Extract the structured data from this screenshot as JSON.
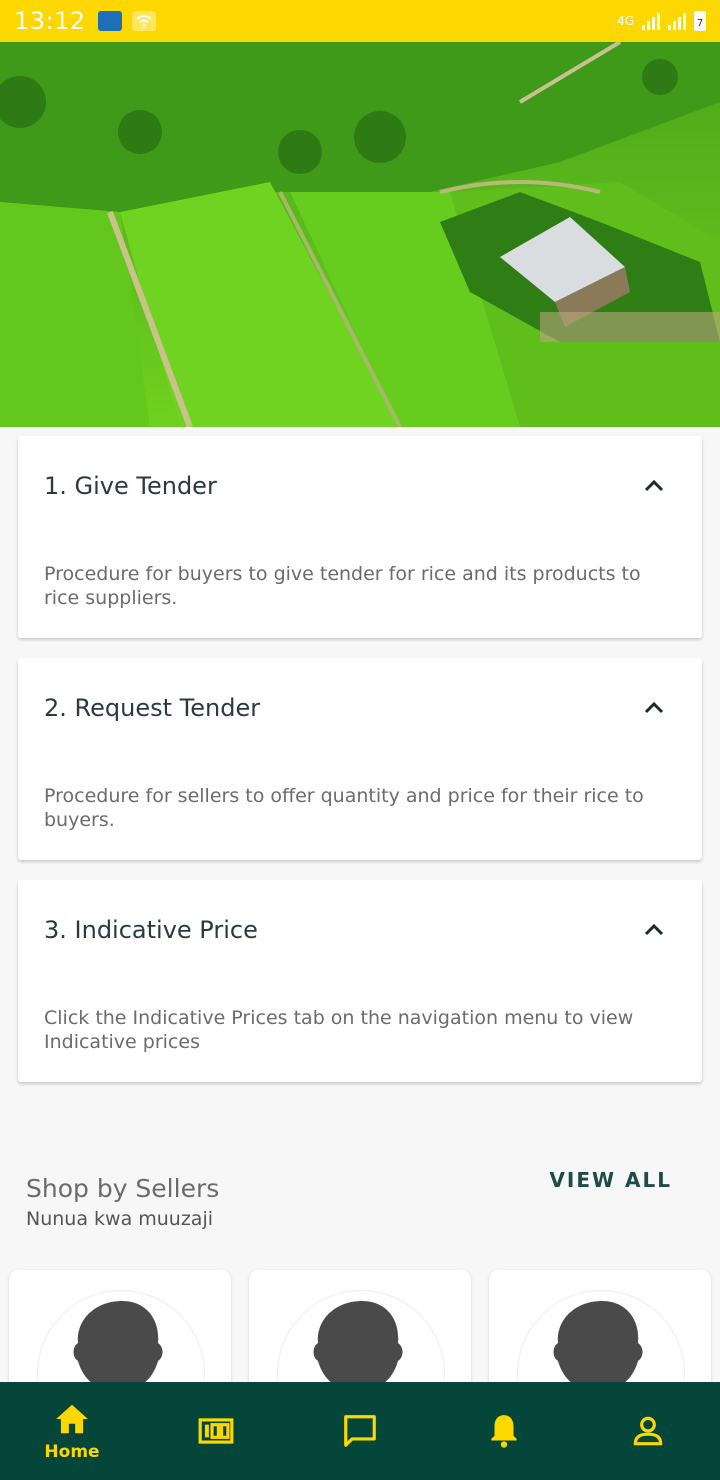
{
  "status_bar": {
    "time": "13:12",
    "network": "4G",
    "battery": "7"
  },
  "tenders": [
    {
      "title": "1. Give Tender",
      "description": "Procedure for buyers to give tender for rice and its products to rice suppliers."
    },
    {
      "title": "2. Request Tender",
      "description": "Procedure for sellers to offer quantity and price for their rice to buyers."
    },
    {
      "title": "3. Indicative Price",
      "description": "Click the Indicative Prices tab on the navigation menu to view Indicative prices"
    }
  ],
  "sellers_section": {
    "title": "Shop by Sellers",
    "subtitle": "Nunua kwa muuzaji",
    "view_all": "VIEW ALL"
  },
  "bottom_nav": {
    "items": [
      {
        "label": "Home",
        "icon": "home-icon",
        "active": true
      },
      {
        "label": "",
        "icon": "price-icon",
        "active": false
      },
      {
        "label": "",
        "icon": "chat-icon",
        "active": false
      },
      {
        "label": "",
        "icon": "bell-icon",
        "active": false
      },
      {
        "label": "",
        "icon": "person-icon",
        "active": false
      }
    ]
  },
  "colors": {
    "status_bar": "#fdd700",
    "nav_background": "#04473a",
    "nav_icon": "#fdd700",
    "title_text": "#2c3a40",
    "view_all": "#1f4d45"
  }
}
